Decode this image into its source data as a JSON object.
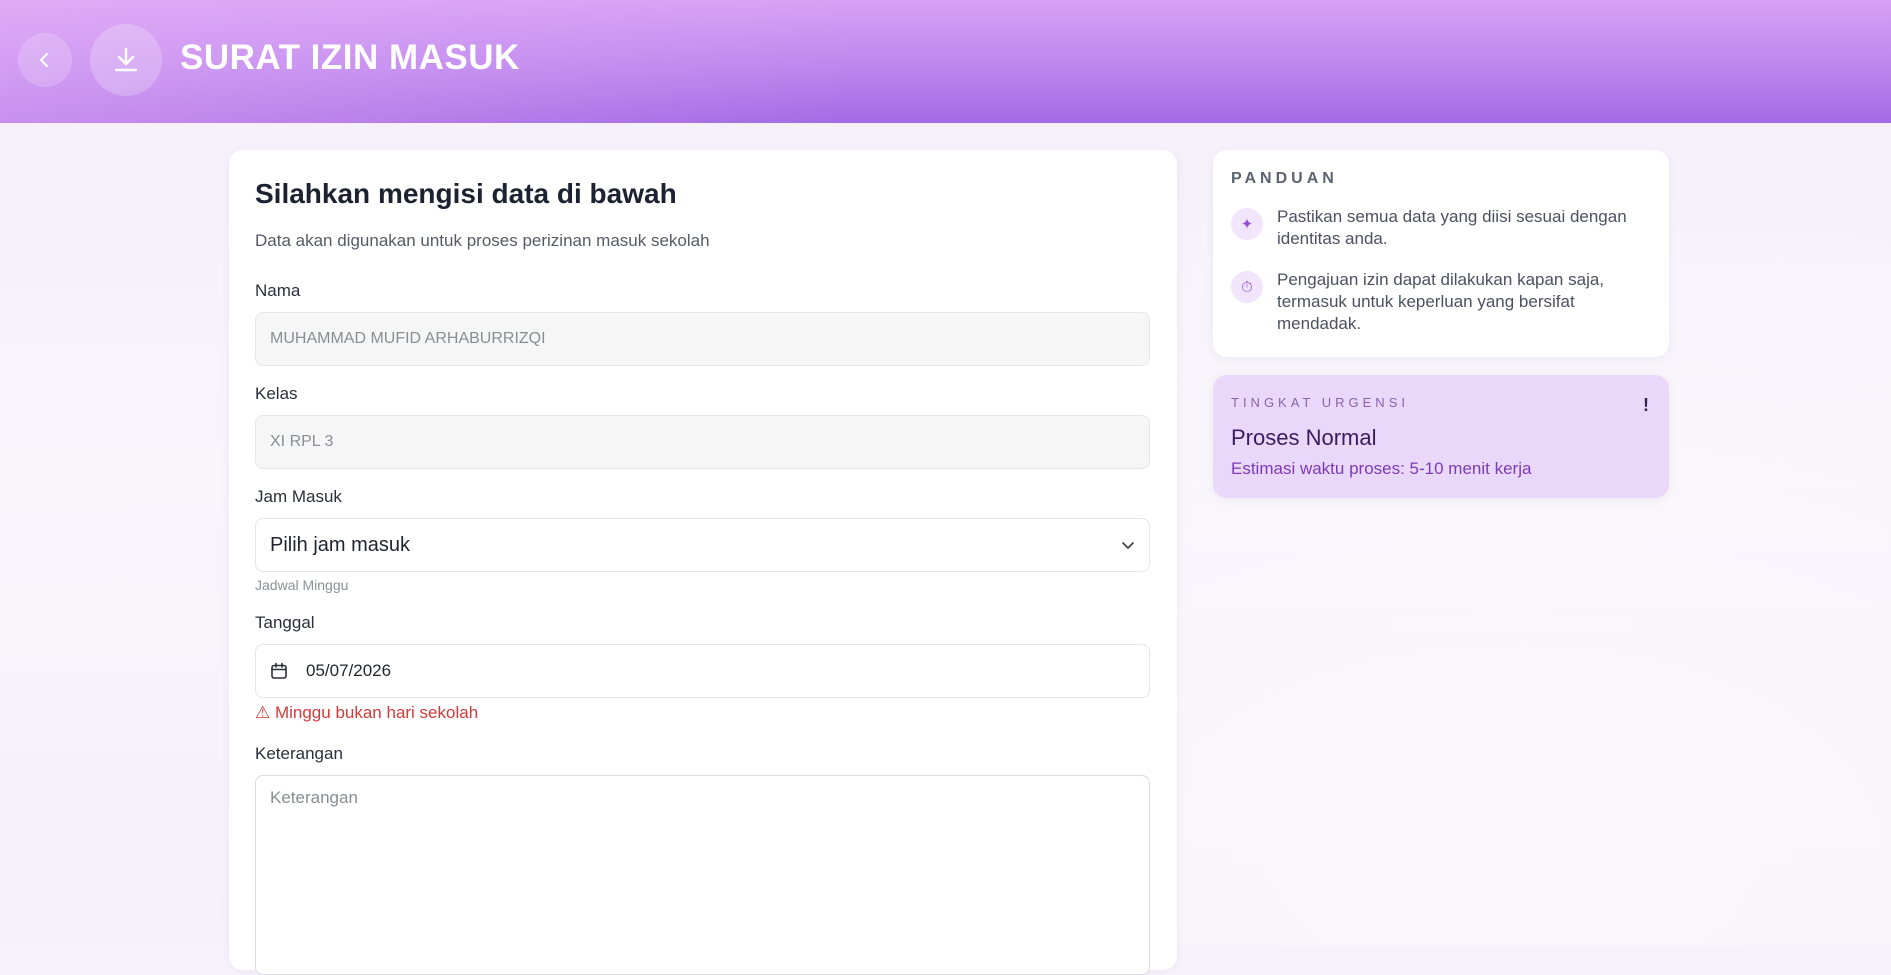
{
  "header": {
    "title": "SURAT IZIN MASUK",
    "back_icon": "chevron-left-icon",
    "download_icon": "download-icon"
  },
  "form": {
    "title": "Silahkan mengisi data di bawah",
    "subtitle": "Data akan digunakan untuk proses perizinan masuk sekolah",
    "nama": {
      "label": "Nama",
      "value": "MUHAMMAD MUFID ARHABURRIZQI"
    },
    "kelas": {
      "label": "Kelas",
      "value": "XI RPL 3"
    },
    "jam_masuk": {
      "label": "Jam Masuk",
      "selected": "Pilih jam masuk",
      "hint": "Jadwal Minggu"
    },
    "tanggal": {
      "label": "Tanggal",
      "value": "05/07/2026",
      "error": "⚠ Minggu bukan hari sekolah"
    },
    "keterangan": {
      "label": "Keterangan",
      "placeholder": "Keterangan"
    }
  },
  "panduan": {
    "title": "PANDUAN",
    "items": [
      {
        "icon": "sparkle-icon",
        "text": "Pastikan semua data yang diisi sesuai dengan identitas anda."
      },
      {
        "icon": "stopwatch-icon",
        "text": "Pengajuan izin dapat dilakukan kapan saja, termasuk untuk keperluan yang bersifat mendadak."
      }
    ]
  },
  "urgensi": {
    "label": "TINGKAT URGENSI",
    "badge": "!",
    "title": "Proses Normal",
    "subtitle": "Estimasi waktu proses: 5-10 menit kerja"
  },
  "colors": {
    "header_top": "#d7a2f4",
    "header_bottom": "#a46ae4",
    "error": "#d33a3a",
    "urgency_bg": "#ead8fb",
    "accent": "#9a4fd8"
  }
}
